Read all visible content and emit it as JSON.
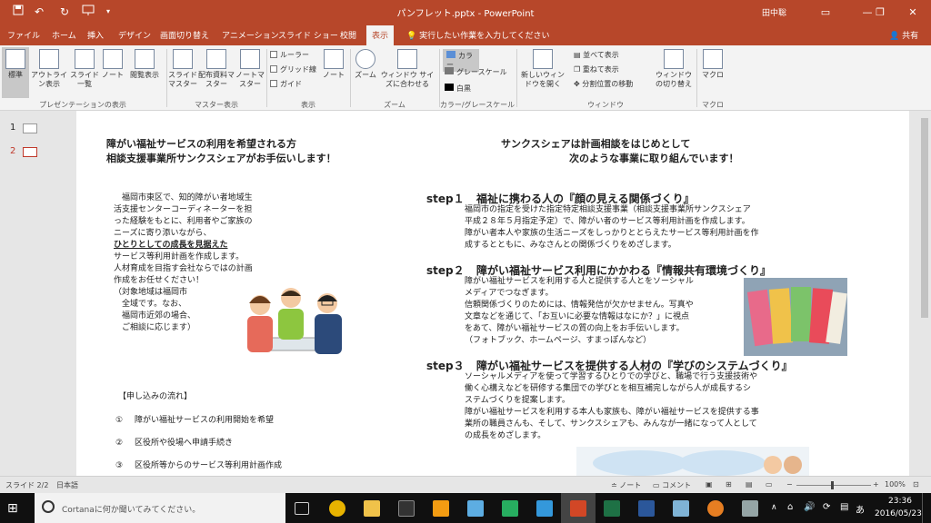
{
  "app": {
    "title": "パンフレット.pptx - PowerPoint",
    "user": "田中聡",
    "share": "共有",
    "tell_me": "実行したい作業を入力してください"
  },
  "colors": {
    "accent": "#b7472a",
    "taskbar": "#101010"
  },
  "window_icons": [
    "save-icon",
    "undo-icon",
    "redo-icon",
    "present-icon",
    "dropdown-icon",
    "ribbon-options-icon",
    "minimize-icon",
    "maximize-icon",
    "close-icon"
  ],
  "tabs": [
    "ファイル",
    "ホーム",
    "挿入",
    "デザイン",
    "画面切り替え",
    "アニメーション",
    "スライド ショー",
    "校閲",
    "表示"
  ],
  "active_tab": "表示",
  "ribbon": {
    "presentation_views": [
      "標準",
      "アウトライン表示",
      "スライド一覧",
      "ノート",
      "閲覧表示"
    ],
    "master_views": [
      "スライドマスター",
      "配布資料マスター",
      "ノートマスター"
    ],
    "show": {
      "ruler": "ルーラー",
      "gridlines": "グリッド線",
      "guides": "ガイド",
      "notes": "ノート"
    },
    "zoom": {
      "zoom": "ズーム",
      "fit": "ウィンドウ サイズに合わせる"
    },
    "color": {
      "color": "カラー",
      "grayscale": "グレースケール",
      "bw": "白黒"
    },
    "window": {
      "new": "新しいウィンドウを開く",
      "arrange": "並べて表示",
      "cascade": "重ねて表示",
      "split": "分割位置の移動",
      "switch": "ウィンドウの切り替え"
    },
    "macro": "マクロ",
    "groups": [
      "プレゼンテーションの表示",
      "マスター表示",
      "表示",
      "ズーム",
      "カラー/グレースケール",
      "ウィンドウ",
      "マクロ"
    ]
  },
  "slides": [
    {
      "num": "1"
    },
    {
      "num": "2"
    }
  ],
  "slide": {
    "left_title1": "障がい福祉サービスの利用を希望される方",
    "left_title2": "相談支援事業所サンクスシェアがお手伝いします！",
    "left_lines": [
      "　福岡市東区で、知的障がい者地域生",
      "活支援センターコーディネーターを担",
      "った経験をもとに、利用者やご家族の",
      "ニーズに寄り添いながら、"
    ],
    "left_emph": "ひとりとしての成長を見据えた",
    "left_lines2": [
      "サービス等利用計画を作成します。",
      "人材育成を目指す会社ならではの計画",
      "作成をお任せください！",
      "（対象地域は福岡市",
      "　全域です。なお、",
      "　福岡市近郊の場合、",
      "　ご相談に応じます）"
    ],
    "flow_title": "【申し込みの流れ】",
    "flow": [
      {
        "n": "①",
        "text": "障がい福祉サービスの利用開始を希望"
      },
      {
        "n": "②",
        "text": "区役所や役場へ申請手続き"
      },
      {
        "n": "③",
        "text": "区役所等からのサービス等利用計画作成"
      }
    ],
    "right_title1": "サンクスシェアは計画相談をはじめとして",
    "right_title2": "次のような事業に取り組んでいます！",
    "steps": [
      {
        "label": "step１",
        "title": "福祉に携わる人の『顔の見える関係づくり』",
        "lines": [
          "福岡市の指定を受けた指定特定相談支援事業（相談支援事業所サンクスシェア",
          "平成２８年５月指定予定）で、障がい者のサービス等利用計画を作成します。",
          "障がい者本人や家族の生活ニーズをしっかりととらえたサービス等利用計画を作",
          "成するとともに、みなさんとの関係づくりをめざします。"
        ]
      },
      {
        "label": "step２",
        "title": "障がい福祉サービス利用にかかわる『情報共有環境づくり』",
        "lines": [
          "障がい福祉サービスを利用する人と提供する人とをソーシャル",
          "メディアでつなぎます。",
          "信頼関係づくりのためには、情報発信が欠かせません。写真や",
          "文章などを通じて、「お互いに必要な情報はなにか？」に視点",
          "をあて、障がい福祉サービスの質の向上をお手伝いします。",
          "（フォトブック、ホームページ、すまっぽんなど）"
        ]
      },
      {
        "label": "step３",
        "title": "障がい福祉サービスを提供する人材の『学びのシステムづくり』",
        "lines": [
          "ソーシャルメディアを使って学習するひとりでの学びと、職場で行う支援技術や",
          "働く心構えなどを研修する集団での学びとを相互補完しながら人が成長するシ",
          "ステムづくりを提案します。",
          "障がい福祉サービスを利用する本人も家族も、障がい福祉サービスを提供する事",
          "業所の職員さんも、そして、サンクスシェアも、みんなが一緒になって人として",
          "の成長をめざします。"
        ]
      }
    ]
  },
  "status": {
    "slide": "スライド 2/2",
    "lang": "日本語",
    "notes": "ノート",
    "comments": "コメント",
    "zoom": "100%"
  },
  "taskbar": {
    "cortana": "Cortanaに何か聞いてみてください。",
    "time": "23:36",
    "date": "2016/05/23",
    "ime": "あ"
  }
}
